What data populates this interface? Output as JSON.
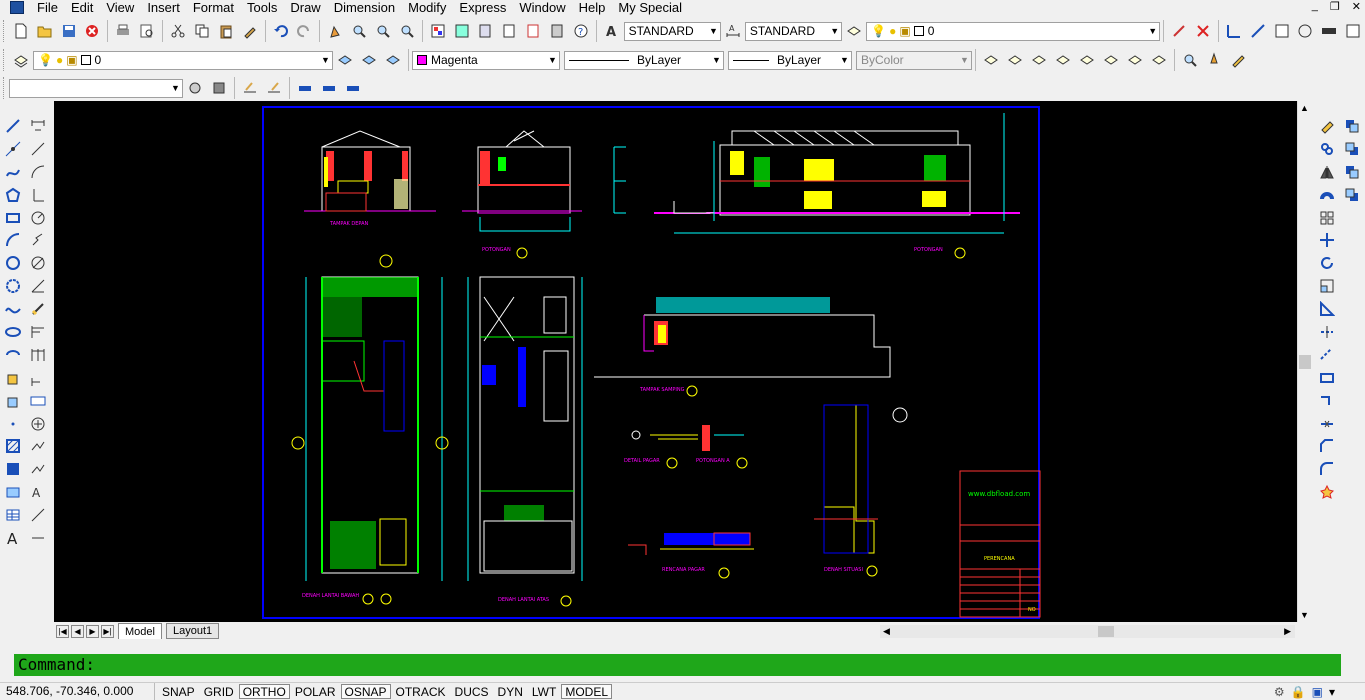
{
  "menu": {
    "items": [
      "File",
      "Edit",
      "View",
      "Insert",
      "Format",
      "Tools",
      "Draw",
      "Dimension",
      "Modify",
      "Express",
      "Window",
      "Help",
      "My Special"
    ]
  },
  "toolbar1": {
    "text_style": "STANDARD",
    "dim_style": "STANDARD",
    "layer": "0"
  },
  "toolbar2": {
    "layer": "0",
    "color": "Magenta",
    "color_hex": "#ff00ff",
    "linetype": "ByLayer",
    "lineweight": "ByLayer",
    "plotstyle": "ByColor"
  },
  "toolbar3": {
    "combo_value": ""
  },
  "tabs": {
    "model": "Model",
    "layout1": "Layout1"
  },
  "command": {
    "prompt": "Command:"
  },
  "status": {
    "coords": "548.706, -70.346, 0.000",
    "buttons": [
      "SNAP",
      "GRID",
      "ORTHO",
      "POLAR",
      "OSNAP",
      "OTRACK",
      "DUCS",
      "DYN",
      "LWT",
      "MODEL"
    ],
    "active": [
      "ORTHO",
      "OSNAP",
      "MODEL"
    ]
  },
  "drawing": {
    "labels": {
      "tampak_depan": "TAMPAK DEPAN",
      "potongan_1": "POTONGAN",
      "potongan_2": "POTONGAN",
      "denah_bawah": "DENAH LANTAI BAWAH",
      "denah_atas": "DENAH LANTAI ATAS",
      "tampak_samping": "TAMPAK SAMPING",
      "detail_pagar": "DETAIL PAGAR",
      "potongan_a": "POTONGAN A",
      "denah_situasi": "DENAH SITUASI",
      "rencana": "RENCANA PAGAR",
      "website": "www.dbfload.com",
      "title_block": "PERENCANA",
      "no": "NO"
    }
  },
  "colors": {
    "canvas": "#000000",
    "command_bg": "#1fa71a",
    "border": "#0000ff"
  }
}
